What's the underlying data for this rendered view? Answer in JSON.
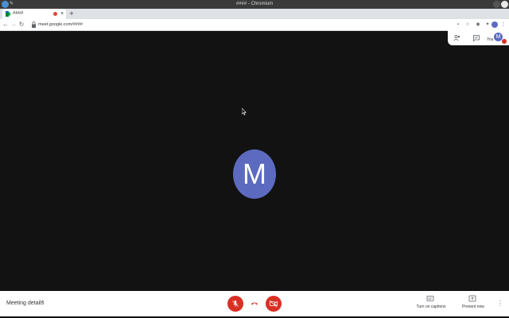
{
  "window": {
    "title": "#### - Chromium"
  },
  "tab": {
    "title": "####",
    "close": "×",
    "new_tab": "+"
  },
  "toolbar": {
    "url": "meet.google.com/####",
    "back": "←",
    "forward": "→",
    "reload": "↻",
    "menu": "⋮"
  },
  "meet": {
    "you_label": "You",
    "self_avatar_letter": "M",
    "participant_avatar_letter": "M",
    "avatar_color": "#5c6bc0",
    "danger_color": "#d93025"
  },
  "bottom": {
    "meeting_details": "Meeting details",
    "details_caret": "^",
    "captions_label": "Turn on captions",
    "present_label": "Present now",
    "more": "⋮"
  }
}
